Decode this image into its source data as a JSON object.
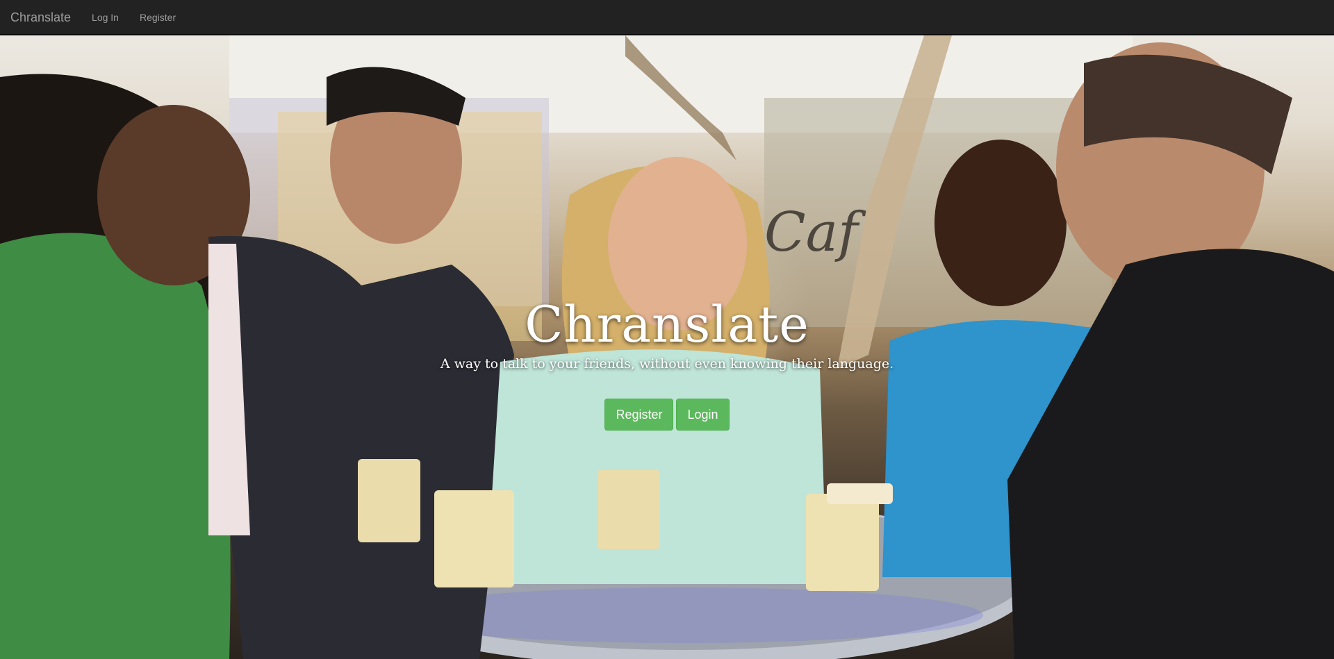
{
  "navbar": {
    "brand": "Chranslate",
    "links": [
      {
        "label": "Log In"
      },
      {
        "label": "Register"
      }
    ]
  },
  "hero": {
    "title": "Chranslate",
    "subtitle": "A way to talk to your friends, without even knowing their language.",
    "buttons": {
      "register": "Register",
      "login": "Login"
    },
    "background_image": "photo-of-five-friends-laughing-with-coffee-cups-at-cafe-table"
  },
  "colors": {
    "navbar_bg": "#222222",
    "navbar_text": "#9d9d9d",
    "button_bg": "#5cb85c",
    "button_text": "#ffffff",
    "hero_text": "#ffffff"
  }
}
